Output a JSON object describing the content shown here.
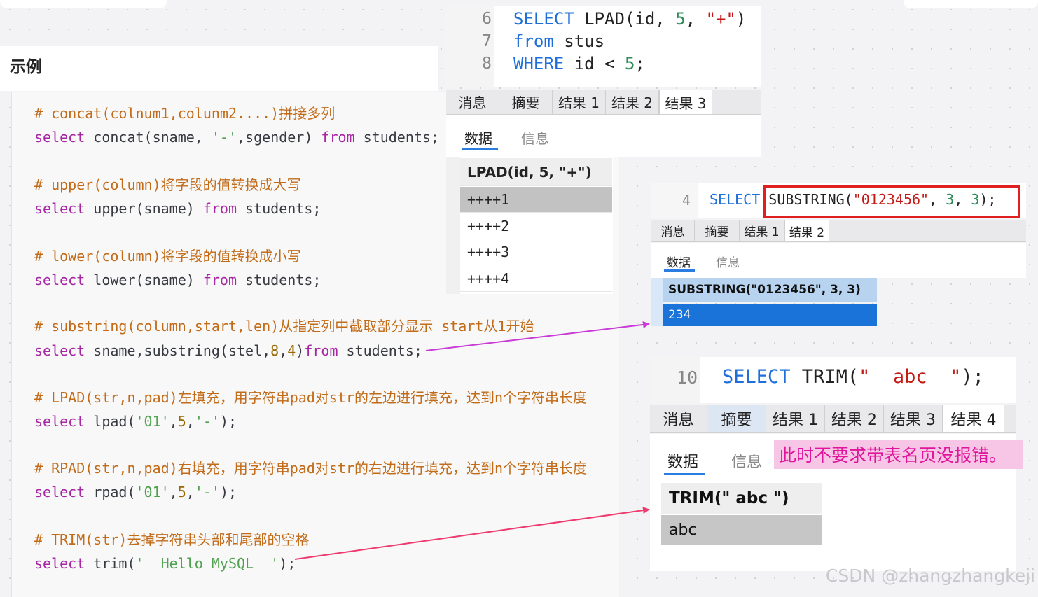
{
  "left_panel": {
    "heading": "示例",
    "lines": [
      {
        "id": "c1",
        "text": "# concat(colnum1,colunm2....)拼接多列"
      },
      {
        "id": "s1",
        "parts": [
          "select",
          " concat(sname, ",
          "'-'",
          ",sgender) ",
          "from",
          " students;"
        ]
      },
      {
        "id": "c2",
        "text": "# upper(column)将字段的值转换成大写"
      },
      {
        "id": "s2",
        "parts": [
          "select",
          " upper(sname) ",
          "from",
          " students;"
        ]
      },
      {
        "id": "c3",
        "text": "# lower(column)将字段的值转换成小写"
      },
      {
        "id": "s3",
        "parts": [
          "select",
          " lower(sname) ",
          "from",
          " students;"
        ]
      },
      {
        "id": "c4",
        "text": "# substring(column,start,len)从指定列中截取部分显示 start从1开始"
      },
      {
        "id": "s4",
        "parts": [
          "select",
          " sname,substring(stel,",
          "8",
          ",",
          "4",
          ")",
          "from",
          " students;"
        ]
      },
      {
        "id": "c5",
        "text": "# LPAD(str,n,pad)左填充，用字符串pad对str的左边进行填充，达到n个字符串长度"
      },
      {
        "id": "s5",
        "parts": [
          "select",
          " lpad(",
          "'01'",
          ",",
          "5",
          ",",
          "'-'",
          ");"
        ]
      },
      {
        "id": "c6",
        "text": "# RPAD(str,n,pad)右填充，用字符串pad对str的右边进行填充，达到n个字符串长度"
      },
      {
        "id": "s6",
        "parts": [
          "select",
          " rpad(",
          "'01'",
          ",",
          "5",
          ",",
          "'-'",
          ");"
        ]
      },
      {
        "id": "c7",
        "text": "# TRIM(str)去掉字符串头部和尾部的空格"
      },
      {
        "id": "s7",
        "parts": [
          "select",
          " trim(",
          "'  Hello MySQL  '",
          ");"
        ]
      }
    ]
  },
  "panel_lpad": {
    "line_numbers": [
      "6",
      "7",
      "8"
    ],
    "sql": {
      "l1": [
        "SELECT",
        " LPAD(id, ",
        "5",
        ", ",
        "\"+\"",
        ")"
      ],
      "l2": [
        "from",
        " stus"
      ],
      "l3": [
        "WHERE",
        " id < ",
        "5",
        ";"
      ]
    },
    "tabs": [
      "消息",
      "摘要",
      "结果 1",
      "结果 2",
      "结果 3"
    ],
    "active_tab": "结果 3",
    "subtabs": [
      "数据",
      "信息"
    ],
    "column_header": "LPAD(id, 5, \"+\")",
    "rows": [
      "++++1",
      "++++2",
      "++++3",
      "++++4"
    ]
  },
  "panel_substring": {
    "line_number": "4",
    "sql": [
      "SELECT",
      " SUBSTRING(",
      "\"0123456\"",
      ", ",
      "3",
      ", ",
      "3",
      ");"
    ],
    "tabs": [
      "消息",
      "摘要",
      "结果 1",
      "结果 2"
    ],
    "active_tab": "结果 2",
    "subtabs": [
      "数据",
      "信息"
    ],
    "column_header": "SUBSTRING(\"0123456\", 3, 3)",
    "rows": [
      "234"
    ]
  },
  "panel_trim": {
    "line_number": "10",
    "sql": [
      "SELECT",
      " TRIM(",
      "\"  abc  \"",
      ");"
    ],
    "tabs": [
      "消息",
      "摘要",
      "结果 1",
      "结果 2",
      "结果 3",
      "结果 4"
    ],
    "active_tab": "结果 4",
    "subtabs": [
      "数据",
      "信息"
    ],
    "note": "此时不要求带表名页没报错。",
    "column_header": "TRIM(\"  abc  \")",
    "rows": [
      "abc"
    ]
  },
  "watermark": "CSDN @zhangzhangkeji",
  "colors": {
    "comment": "#c26b19",
    "keyword": "#a626a4",
    "arrow_purple": "#c93bd6",
    "arrow_pink": "#ee3a6f",
    "redbox": "#e02020",
    "note_bg": "#f7c6e6",
    "note_text": "#e0159b",
    "selected_row": "#1a73d9"
  }
}
